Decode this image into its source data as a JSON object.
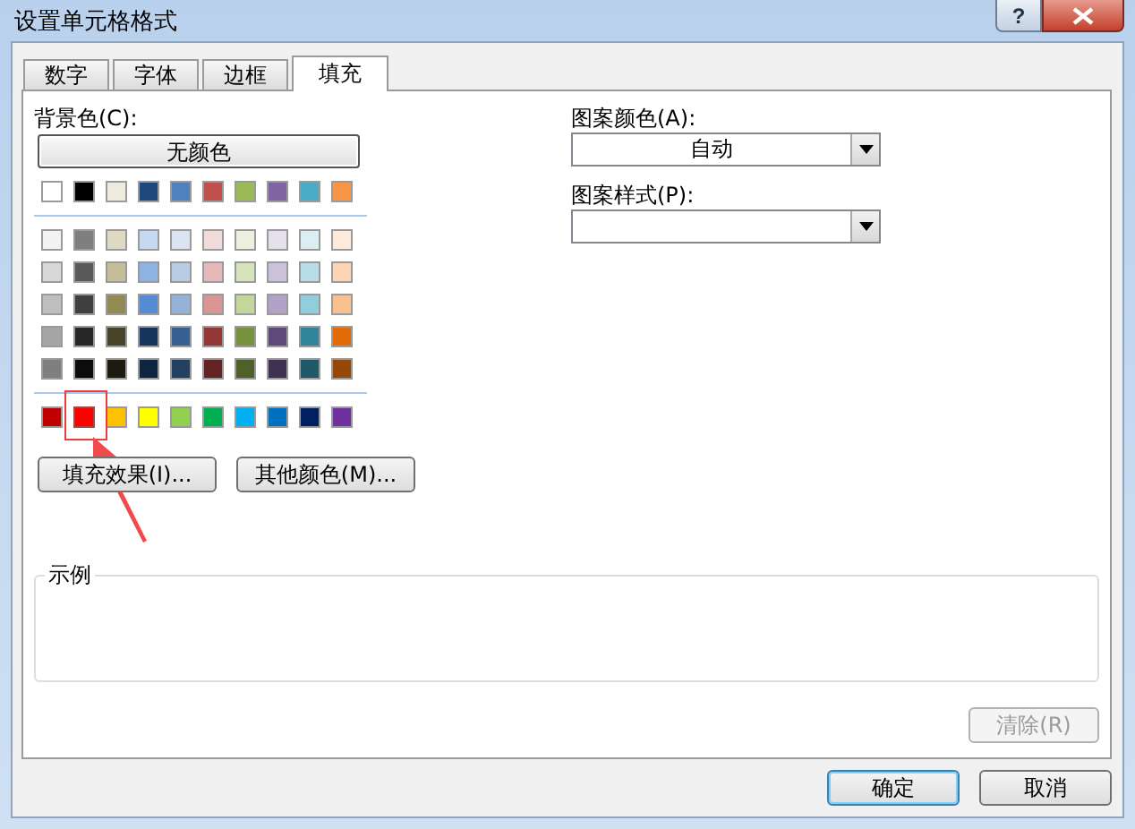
{
  "window": {
    "title": "设置单元格格式",
    "help_button": "?"
  },
  "tabs": [
    {
      "label": "数字",
      "selected": false
    },
    {
      "label": "字体",
      "selected": false
    },
    {
      "label": "边框",
      "selected": false
    },
    {
      "label": "填充",
      "selected": true
    }
  ],
  "background_color": {
    "label": "背景色(C):",
    "no_color_button": "无颜色",
    "palette_groups": [
      [
        [
          {
            "color": "#ffffff",
            "highlighted": false
          },
          {
            "color": "#000000",
            "highlighted": false
          },
          {
            "color": "#eeece1",
            "highlighted": false
          },
          {
            "color": "#1f497d",
            "highlighted": false
          },
          {
            "color": "#4f81bd",
            "highlighted": false
          },
          {
            "color": "#c0504d",
            "highlighted": false
          },
          {
            "color": "#9bbb59",
            "highlighted": false
          },
          {
            "color": "#8064a2",
            "highlighted": false
          },
          {
            "color": "#4bacc6",
            "highlighted": false
          },
          {
            "color": "#f79646",
            "highlighted": false
          }
        ]
      ],
      [
        [
          {
            "color": "#f2f2f2",
            "highlighted": false
          },
          {
            "color": "#7f7f7f",
            "highlighted": false
          },
          {
            "color": "#ddd9c3",
            "highlighted": false
          },
          {
            "color": "#c6d9f0",
            "highlighted": false
          },
          {
            "color": "#dbe5f1",
            "highlighted": false
          },
          {
            "color": "#f2dcdb",
            "highlighted": false
          },
          {
            "color": "#ebf1dd",
            "highlighted": false
          },
          {
            "color": "#e5e0ec",
            "highlighted": false
          },
          {
            "color": "#dbeef3",
            "highlighted": false
          },
          {
            "color": "#fdeada",
            "highlighted": false
          }
        ],
        [
          {
            "color": "#d8d8d8",
            "highlighted": false
          },
          {
            "color": "#595959",
            "highlighted": false
          },
          {
            "color": "#c4bd97",
            "highlighted": false
          },
          {
            "color": "#8db3e2",
            "highlighted": false
          },
          {
            "color": "#b8cce4",
            "highlighted": false
          },
          {
            "color": "#e5b9b7",
            "highlighted": false
          },
          {
            "color": "#d7e3bc",
            "highlighted": false
          },
          {
            "color": "#ccc1d9",
            "highlighted": false
          },
          {
            "color": "#b7dde8",
            "highlighted": false
          },
          {
            "color": "#fbd5b5",
            "highlighted": false
          }
        ],
        [
          {
            "color": "#bfbfbf",
            "highlighted": false
          },
          {
            "color": "#3f3f3f",
            "highlighted": false
          },
          {
            "color": "#938953",
            "highlighted": false
          },
          {
            "color": "#548dd4",
            "highlighted": false
          },
          {
            "color": "#95b3d7",
            "highlighted": false
          },
          {
            "color": "#d99694",
            "highlighted": false
          },
          {
            "color": "#c3d69b",
            "highlighted": false
          },
          {
            "color": "#b2a2c7",
            "highlighted": false
          },
          {
            "color": "#92cddc",
            "highlighted": false
          },
          {
            "color": "#fac08f",
            "highlighted": false
          }
        ],
        [
          {
            "color": "#a5a5a5",
            "highlighted": false
          },
          {
            "color": "#262626",
            "highlighted": false
          },
          {
            "color": "#494429",
            "highlighted": false
          },
          {
            "color": "#17365d",
            "highlighted": false
          },
          {
            "color": "#366092",
            "highlighted": false
          },
          {
            "color": "#953734",
            "highlighted": false
          },
          {
            "color": "#76923c",
            "highlighted": false
          },
          {
            "color": "#5f497a",
            "highlighted": false
          },
          {
            "color": "#31859b",
            "highlighted": false
          },
          {
            "color": "#e36c09",
            "highlighted": false
          }
        ],
        [
          {
            "color": "#7f7f7f",
            "highlighted": false
          },
          {
            "color": "#0c0c0c",
            "highlighted": false
          },
          {
            "color": "#1d1b10",
            "highlighted": false
          },
          {
            "color": "#0f243e",
            "highlighted": false
          },
          {
            "color": "#244061",
            "highlighted": false
          },
          {
            "color": "#632423",
            "highlighted": false
          },
          {
            "color": "#4f6128",
            "highlighted": false
          },
          {
            "color": "#3f3151",
            "highlighted": false
          },
          {
            "color": "#205867",
            "highlighted": false
          },
          {
            "color": "#974806",
            "highlighted": false
          }
        ]
      ],
      [
        [
          {
            "color": "#c00000",
            "highlighted": false
          },
          {
            "color": "#ff0000",
            "highlighted": true
          },
          {
            "color": "#ffc000",
            "highlighted": false
          },
          {
            "color": "#ffff00",
            "highlighted": false
          },
          {
            "color": "#92d050",
            "highlighted": false
          },
          {
            "color": "#00b050",
            "highlighted": false
          },
          {
            "color": "#00b0f0",
            "highlighted": false
          },
          {
            "color": "#0070c0",
            "highlighted": false
          },
          {
            "color": "#002060",
            "highlighted": false
          },
          {
            "color": "#7030a0",
            "highlighted": false
          }
        ]
      ]
    ],
    "buttons": [
      "填充效果(I)...",
      "其他颜色(M)..."
    ]
  },
  "pattern_color": {
    "label": "图案颜色(A):",
    "value": "自动"
  },
  "pattern_style": {
    "label": "图案样式(P):"
  },
  "sample": {
    "label": "示例",
    "clear_button": {
      "label": "清除(R)",
      "disabled": true
    }
  },
  "footer_buttons": [
    {
      "label": "确定",
      "default": true
    },
    {
      "label": "取消",
      "default": false
    }
  ]
}
